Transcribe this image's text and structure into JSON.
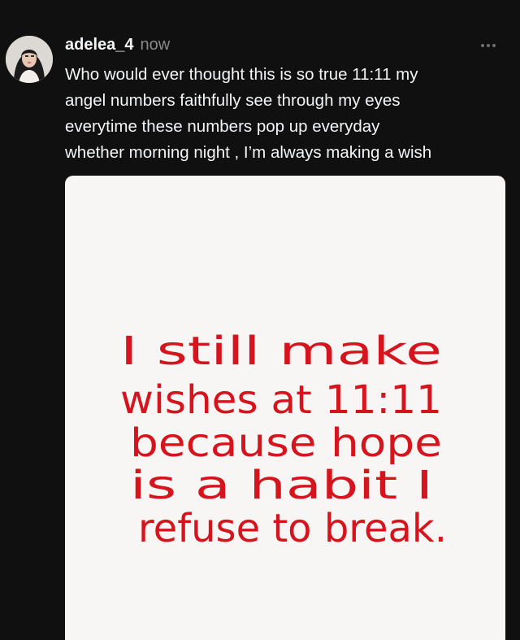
{
  "post": {
    "username": "adelea_4",
    "timestamp": "now",
    "more_icon": "ellipsis-icon",
    "caption_lines": [
      "Who would ever thought this is so true 11:11 my",
      "angel numbers faithfully see through my eyes",
      "everytime these numbers pop up everyday",
      "whether morning night , I’m always making a wish"
    ]
  },
  "image": {
    "handwritten_lines": [
      "I still make",
      "wishes at 11:11",
      "because hope",
      "is a habit I",
      "refuse to break."
    ],
    "ink_color": "#d6141d",
    "paper_color": "#f7f6f5"
  },
  "colors": {
    "background": "#101010",
    "text": "#f3f5f7",
    "muted": "#8a8a8a"
  }
}
